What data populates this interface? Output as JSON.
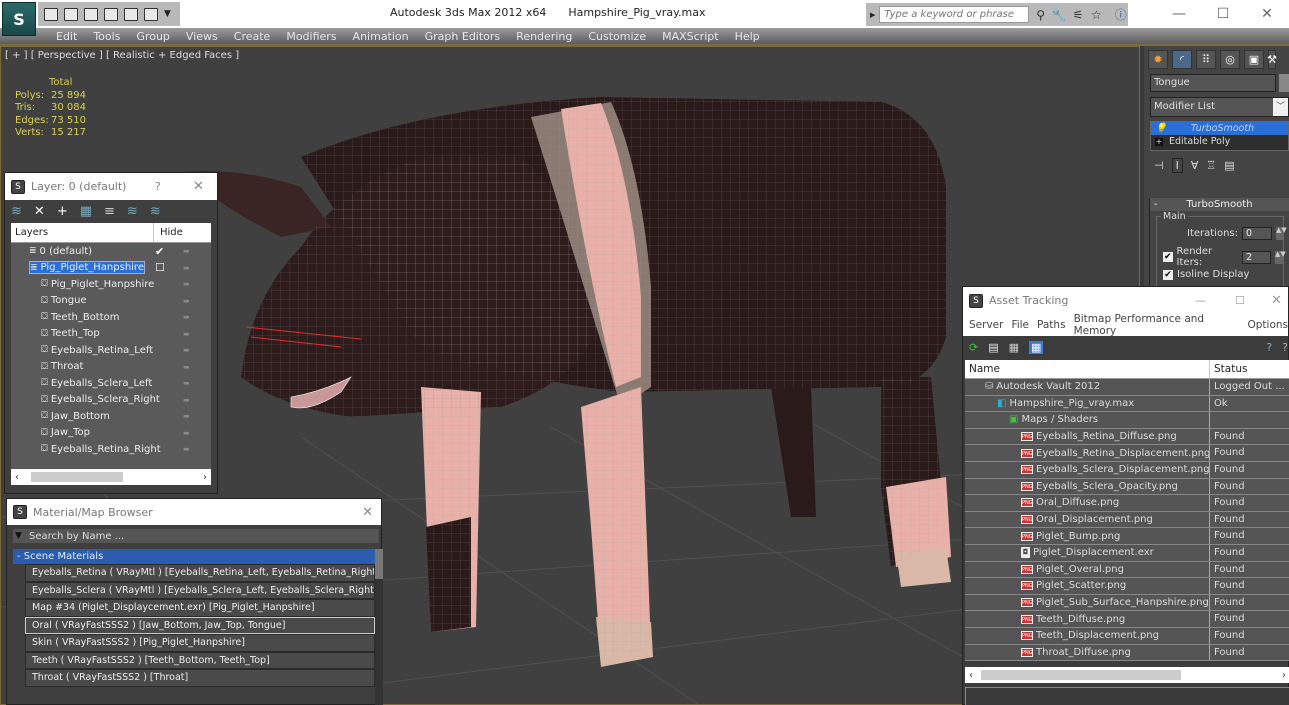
{
  "app": {
    "title": "Autodesk 3ds Max  2012 x64",
    "file": "Hampshire_Pig_vray.max",
    "logo": "3ds-max-logo"
  },
  "quick_access": [
    "open-file-icon",
    "save-icon",
    "new-scene-icon",
    "reference-icon",
    "undo-icon",
    "redo-icon"
  ],
  "search": {
    "placeholder": "Type a keyword or phrase"
  },
  "infocenter_icons": [
    "binoculars-icon",
    "key-icon",
    "satellite-icon",
    "star-icon",
    "help-icon"
  ],
  "window_controls": {
    "minimize": "—",
    "maximize": "☐",
    "close": "✕"
  },
  "menubar": [
    "Edit",
    "Tools",
    "Group",
    "Views",
    "Create",
    "Modifiers",
    "Animation",
    "Graph Editors",
    "Rendering",
    "Customize",
    "MAXScript",
    "Help"
  ],
  "viewport": {
    "label": "[ + ] [ Perspective ] [ Realistic + Edged Faces ]",
    "stats": {
      "header": "Total",
      "rows": [
        {
          "label": "Polys:",
          "value": "25 894"
        },
        {
          "label": "Tris:",
          "value": "30 084"
        },
        {
          "label": "Edges:",
          "value": "73 510"
        },
        {
          "label": "Verts:",
          "value": "15 217"
        }
      ]
    },
    "colors": {
      "pig_dark": "#2a1a1a",
      "pig_pink": "#e8b0a8",
      "band_grey": "#8a7a72",
      "stats_text": "#dcd050"
    }
  },
  "command_panel": {
    "object_name": "Tongue",
    "modifier_list": "Modifier List",
    "stack": [
      {
        "label": "TurboSmooth",
        "selected": true
      },
      {
        "label": "Editable Poly",
        "selected": false
      }
    ],
    "rollout": {
      "title": "TurboSmooth",
      "group": "Main",
      "iterations_label": "Iterations:",
      "iterations": "0",
      "render_iters_label": "Render Iters:",
      "render_iters": "2",
      "render_iters_checked": true,
      "isoline_label": "Isoline Display",
      "isoline_checked": true
    }
  },
  "layer_window": {
    "title": "Layer: 0 (default)",
    "help": "?",
    "close": "✕",
    "columns": {
      "layers": "Layers",
      "hide": "Hide"
    },
    "rows": [
      {
        "name": "0 (default)",
        "type": "layer",
        "level": 0,
        "current": true
      },
      {
        "name": "Pig_Piglet_Hanpshire",
        "type": "layer",
        "level": 0,
        "selected": true
      },
      {
        "name": "Pig_Piglet_Hanpshire",
        "type": "object",
        "level": 1
      },
      {
        "name": "Tongue",
        "type": "object",
        "level": 1
      },
      {
        "name": "Teeth_Bottom",
        "type": "object",
        "level": 1
      },
      {
        "name": "Teeth_Top",
        "type": "object",
        "level": 1
      },
      {
        "name": "Eyeballs_Retina_Left",
        "type": "object",
        "level": 1
      },
      {
        "name": "Throat",
        "type": "object",
        "level": 1
      },
      {
        "name": "Eyeballs_Sclera_Left",
        "type": "object",
        "level": 1
      },
      {
        "name": "Eyeballs_Sclera_Right",
        "type": "object",
        "level": 1
      },
      {
        "name": "Jaw_Bottom",
        "type": "object",
        "level": 1
      },
      {
        "name": "Jaw_Top",
        "type": "object",
        "level": 1
      },
      {
        "name": "Eyeballs_Retina_Right",
        "type": "object",
        "level": 1
      }
    ]
  },
  "material_browser": {
    "title": "Material/Map Browser",
    "close": "✕",
    "search_placeholder": "Search by Name ...",
    "group": "- Scene Materials",
    "items": [
      {
        "label": "Eyeballs_Retina  ( VRayMtl )  [Eyeballs_Retina_Left, Eyeballs_Retina_Right]"
      },
      {
        "label": "Eyeballs_Sclera  ( VRayMtl )  [Eyeballs_Sclera_Left, Eyeballs_Sclera_Right]"
      },
      {
        "label": "Map #34 (Piglet_Displaycement.exr)  [Pig_Piglet_Hanpshire]"
      },
      {
        "label": "Oral  ( VRayFastSSS2 )  [Jaw_Bottom, Jaw_Top, Tongue]",
        "selected": true
      },
      {
        "label": "Skin  ( VRayFastSSS2 )  [Pig_Piglet_Hanpshire]"
      },
      {
        "label": "Teeth  ( VRayFastSSS2 )  [Teeth_Bottom, Teeth_Top]"
      },
      {
        "label": "Throat  ( VRayFastSSS2 )  [Throat]"
      }
    ]
  },
  "asset_tracking": {
    "title": "Asset Tracking",
    "menu": [
      "Server",
      "File",
      "Paths",
      "Bitmap Performance and Memory",
      "Options"
    ],
    "columns": {
      "name": "Name",
      "status": "Status"
    },
    "rows": [
      {
        "name": "Autodesk Vault 2012",
        "status": "Logged Out ...",
        "level": 0,
        "icon": "vault-icon"
      },
      {
        "name": "Hampshire_Pig_vray.max",
        "status": "Ok",
        "level": 1,
        "icon": "max-file-icon"
      },
      {
        "name": "Maps / Shaders",
        "status": "",
        "level": 2,
        "icon": "maps-folder-icon"
      },
      {
        "name": "Eyeballs_Retina_Diffuse.png",
        "status": "Found",
        "level": 3,
        "icon": "png-icon"
      },
      {
        "name": "Eyeballs_Retina_Displacement.png",
        "status": "Found",
        "level": 3,
        "icon": "png-icon"
      },
      {
        "name": "Eyeballs_Sclera_Displacement.png",
        "status": "Found",
        "level": 3,
        "icon": "png-icon"
      },
      {
        "name": "Eyeballs_Sclera_Opacity.png",
        "status": "Found",
        "level": 3,
        "icon": "png-icon"
      },
      {
        "name": "Oral_Diffuse.png",
        "status": "Found",
        "level": 3,
        "icon": "png-icon"
      },
      {
        "name": "Oral_Displacement.png",
        "status": "Found",
        "level": 3,
        "icon": "png-icon"
      },
      {
        "name": "Piglet_Bump.png",
        "status": "Found",
        "level": 3,
        "icon": "png-icon"
      },
      {
        "name": "Piglet_Displacement.exr",
        "status": "Found",
        "level": 3,
        "icon": "exr-icon"
      },
      {
        "name": "Piglet_Overal.png",
        "status": "Found",
        "level": 3,
        "icon": "png-icon"
      },
      {
        "name": "Piglet_Scatter.png",
        "status": "Found",
        "level": 3,
        "icon": "png-icon"
      },
      {
        "name": "Piglet_Sub_Surface_Hanpshire.png",
        "status": "Found",
        "level": 3,
        "icon": "png-icon"
      },
      {
        "name": "Teeth_Diffuse.png",
        "status": "Found",
        "level": 3,
        "icon": "png-icon"
      },
      {
        "name": "Teeth_Displacement.png",
        "status": "Found",
        "level": 3,
        "icon": "png-icon"
      },
      {
        "name": "Throat_Diffuse.png",
        "status": "Found",
        "level": 3,
        "icon": "png-icon"
      }
    ]
  }
}
